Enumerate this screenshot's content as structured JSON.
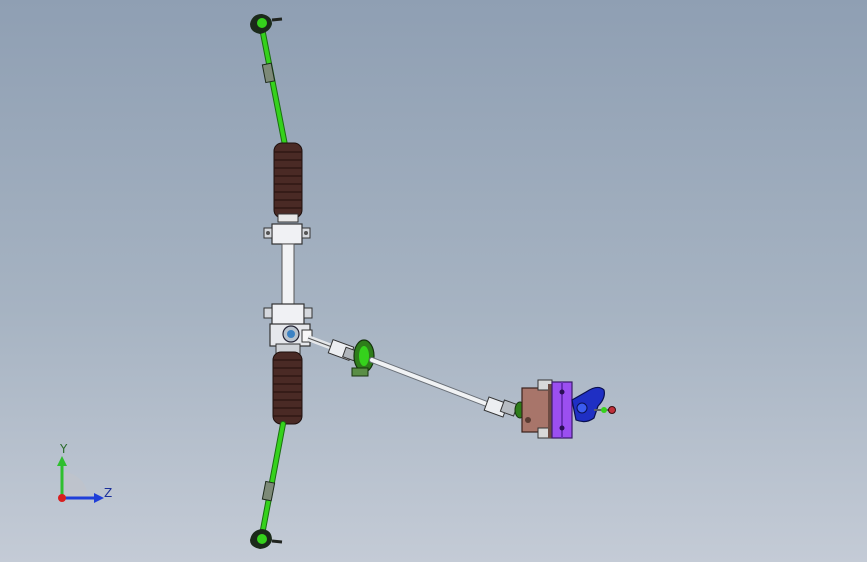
{
  "viewport": {
    "background_top": "#8f9fb3",
    "background_bottom": "#c4cbd6"
  },
  "colors": {
    "tie_rod_green": "#35d21c",
    "bellows_brown": "#4a2a25",
    "housing_white": "#f0f1f4",
    "shaft_grey": "#dfe3e8",
    "bracket_brown": "#a8756a",
    "mount_purple": "#9b4ff0",
    "knuckle_blue": "#1f2fc4"
  },
  "triad": {
    "y_label": "Y",
    "z_label": "Z",
    "y_color": "#2fbf2f",
    "z_color": "#1f3fd9",
    "x_color": "#d81e1e"
  }
}
